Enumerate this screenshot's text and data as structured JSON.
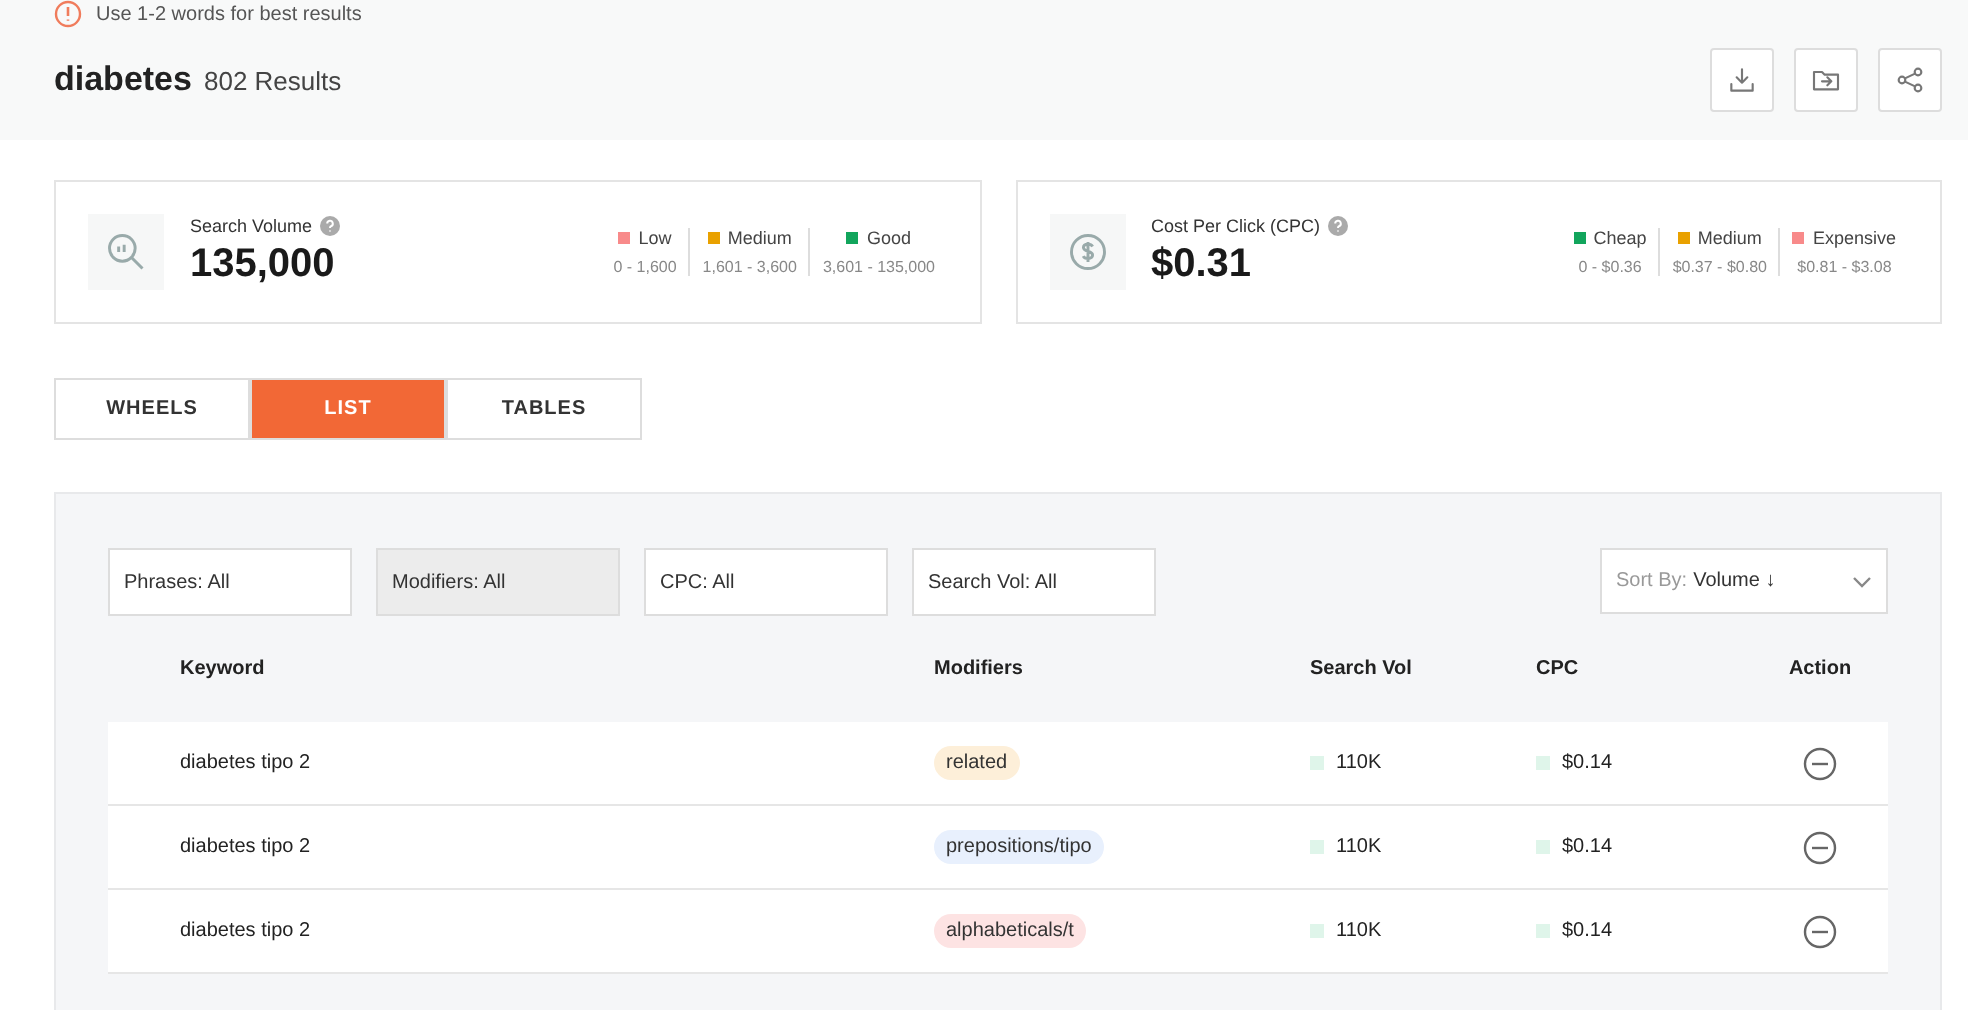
{
  "hint": "Use 1-2 words for best results",
  "query": {
    "term": "diabetes",
    "results": "802 Results"
  },
  "metrics": [
    {
      "kind": "volume",
      "title": "Search Volume",
      "value": "135,000",
      "legend": [
        {
          "label": "Low",
          "range": "0 - 1,600",
          "color": "#f88a8a"
        },
        {
          "label": "Medium",
          "range": "1,601 - 3,600",
          "color": "#e9a100"
        },
        {
          "label": "Good",
          "range": "3,601 - 135,000",
          "color": "#12a55c"
        }
      ]
    },
    {
      "kind": "cost",
      "title": "Cost Per Click (CPC)",
      "value": "$0.31",
      "legend": [
        {
          "label": "Cheap",
          "range": "0 - $0.36",
          "color": "#12a55c"
        },
        {
          "label": "Medium",
          "range": "$0.37 - $0.80",
          "color": "#e9a100"
        },
        {
          "label": "Expensive",
          "range": "$0.81 - $3.08",
          "color": "#f88a8a"
        }
      ]
    }
  ],
  "tabs": [
    {
      "label": "WHEELS",
      "selected": false
    },
    {
      "label": "LIST",
      "selected": true
    },
    {
      "label": "TABLES",
      "selected": false
    }
  ],
  "filters": [
    {
      "label": "Phrases: All",
      "active": false
    },
    {
      "label": "Modifiers: All",
      "active": true
    },
    {
      "label": "CPC: All",
      "active": false
    },
    {
      "label": "Search Vol: All",
      "active": false
    }
  ],
  "sort": {
    "label": "Sort By:",
    "value": "Volume ↓"
  },
  "table": {
    "columns": [
      "Keyword",
      "Modifiers",
      "Search Vol",
      "CPC",
      "Action"
    ],
    "rows": [
      {
        "keyword": "diabetes tipo 2",
        "modifier": "related",
        "color": "#fdefd9",
        "volume": "110K",
        "cpc": "$0.14"
      },
      {
        "keyword": "diabetes tipo 2",
        "modifier": "prepositions/tipo",
        "color": "#e8f0fd",
        "volume": "110K",
        "cpc": "$0.14"
      },
      {
        "keyword": "diabetes tipo 2",
        "modifier": "alphabeticals/t",
        "color": "#fde3e3",
        "volume": "110K",
        "cpc": "$0.14"
      }
    ]
  }
}
